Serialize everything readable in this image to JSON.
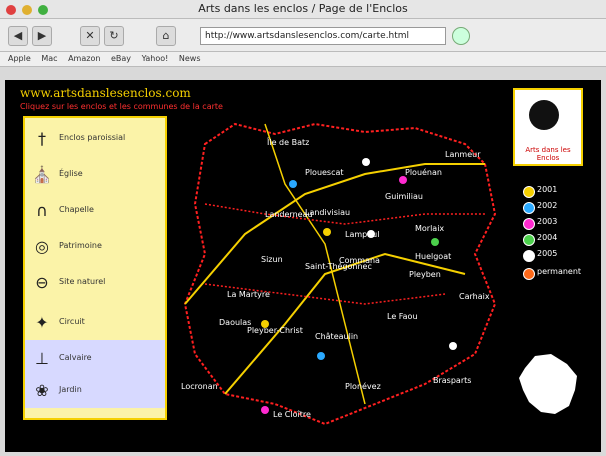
{
  "window": {
    "title": "Arts dans les enclos / Page de l'Enclos"
  },
  "toolbar": {
    "back": "◀",
    "forward": "▶",
    "stop": "✕",
    "reload": "↻",
    "home": "⌂",
    "url": "http://www.artsdanslesenclos.com/carte.html"
  },
  "bookmarks": [
    "Apple",
    "Mac",
    "Amazon",
    "eBay",
    "Yahoo!",
    "News"
  ],
  "page": {
    "site_title": "www.artsdanslesenclos.com",
    "tagline": "Cliquez sur les enclos et les communes de la carte"
  },
  "legend": [
    {
      "icon": "†",
      "label": "Enclos paroissial"
    },
    {
      "icon": "⛪",
      "label": "Église"
    },
    {
      "icon": "∩",
      "label": "Chapelle"
    },
    {
      "icon": "◎",
      "label": "Patrimoine"
    },
    {
      "icon": "⊖",
      "label": "Site naturel"
    },
    {
      "icon": "⊥",
      "label": "Calvaire"
    },
    {
      "icon": "❀",
      "label": "Jardin"
    },
    {
      "icon": "✦",
      "label": "Circuit"
    }
  ],
  "logo": {
    "text": "Arts dans les Enclos"
  },
  "years": [
    {
      "label": "2001",
      "color": "#f5d000"
    },
    {
      "label": "2002",
      "color": "#2aa9ff"
    },
    {
      "label": "2003",
      "color": "#ff2ad0"
    },
    {
      "label": "2004",
      "color": "#4cd04c"
    },
    {
      "label": "2005",
      "color": "#ffffff"
    },
    {
      "label": "permanent",
      "color": "#ff6a1a"
    }
  ],
  "towns": [
    "Île de Batz",
    "Plouescat",
    "Lanmeur",
    "Landivisiau",
    "Guimiliau",
    "Lampaul",
    "Plouénan",
    "Morlaix",
    "Saint-Thégonnec",
    "Pleyber-Christ",
    "Sizun",
    "Commana",
    "Landerneau",
    "La Martyre",
    "Daoulas",
    "Le Faou",
    "Châteaulin",
    "Pleyben",
    "Carhaix",
    "Huelgoat",
    "Locronan",
    "Plonévez",
    "Le Cloître",
    "Brasparts"
  ]
}
